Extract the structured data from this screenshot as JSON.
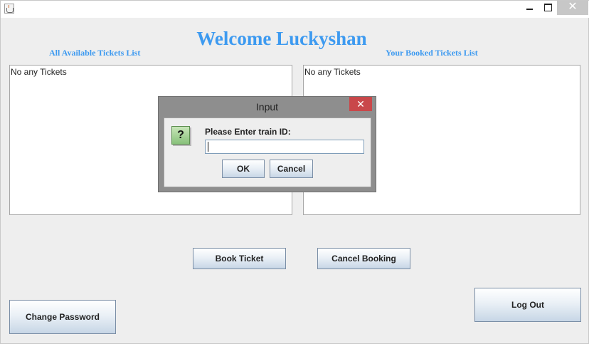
{
  "window": {
    "minimize_glyph": "_",
    "close_glyph": "✕"
  },
  "main": {
    "welcome": "Welcome Luckyshan",
    "available_label": "All Available Tickets List",
    "booked_label": "Your Booked Tickets List",
    "available_items": [
      "No any Tickets"
    ],
    "booked_items": [
      "No any Tickets"
    ],
    "buttons": {
      "book": "Book Ticket",
      "cancel_booking": "Cancel Booking",
      "change_password": "Change Password",
      "logout": "Log Out"
    }
  },
  "dialog": {
    "title": "Input",
    "close_glyph": "✕",
    "icon_glyph": "?",
    "prompt": "Please Enter train ID:",
    "input_value": "",
    "ok_label": "OK",
    "cancel_label": "Cancel"
  },
  "colors": {
    "accent_text": "#3d9af0",
    "dialog_close": "#c9474a",
    "button_border": "#7a8ea6"
  }
}
